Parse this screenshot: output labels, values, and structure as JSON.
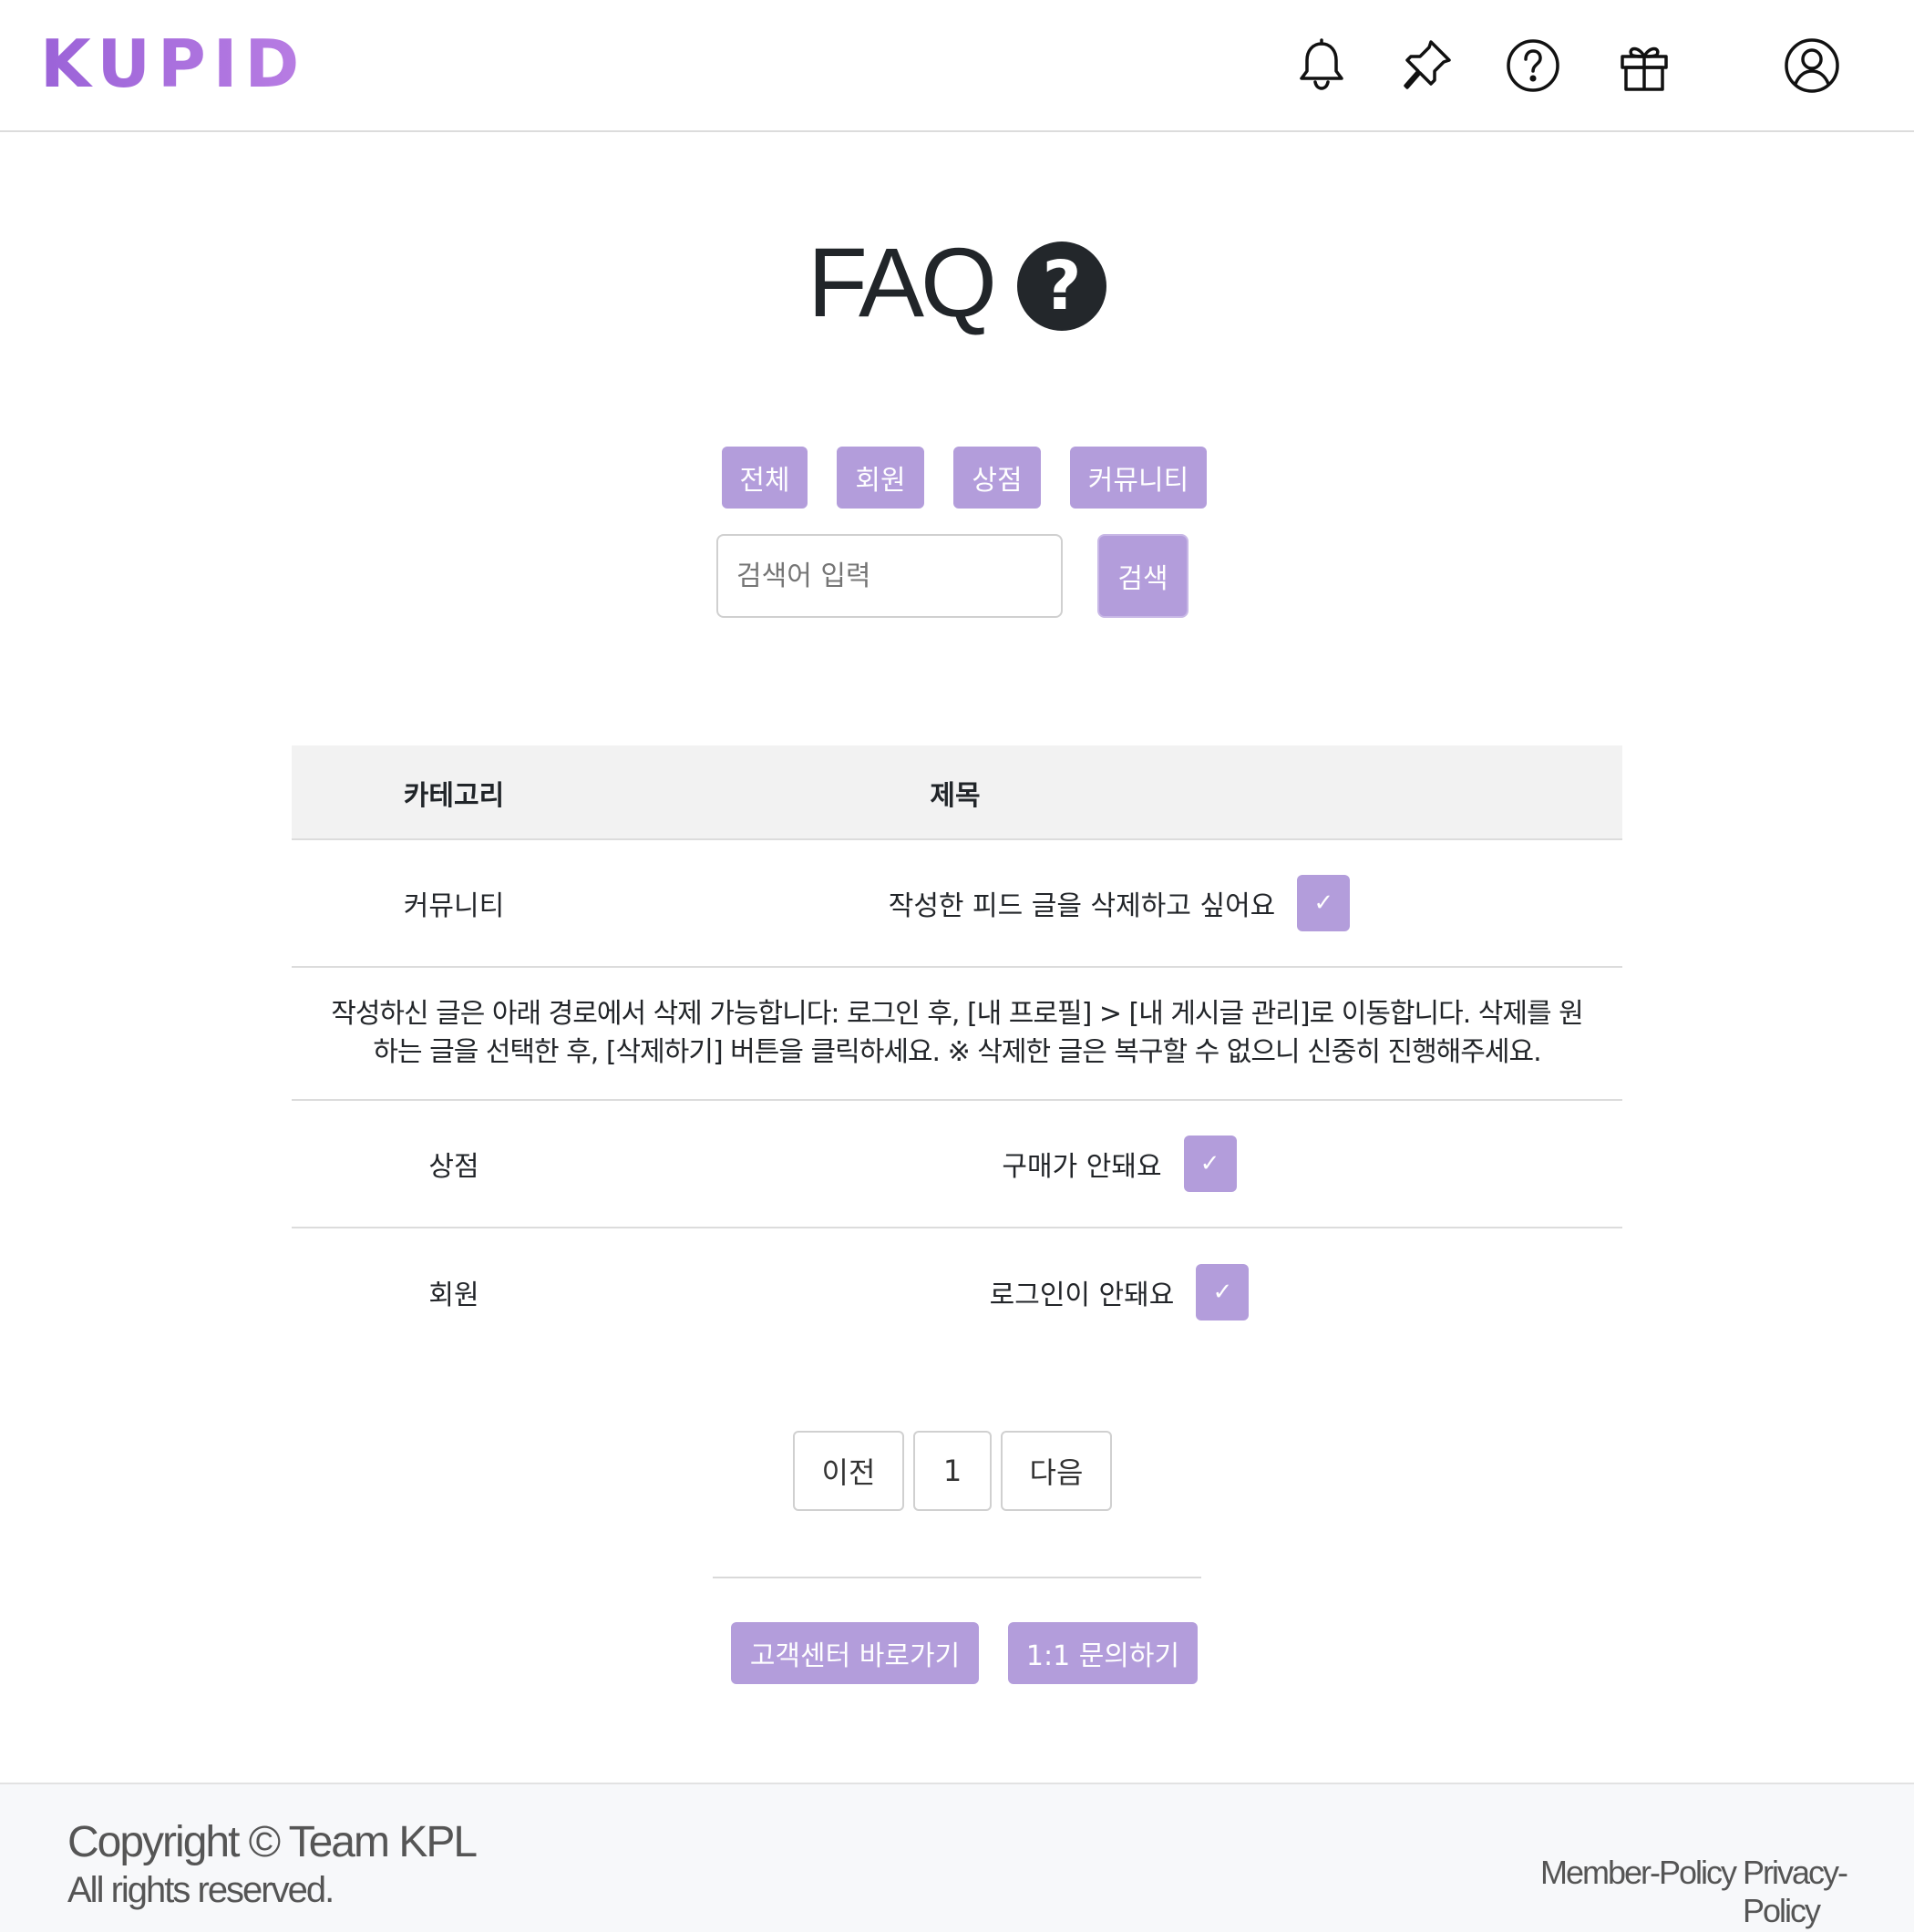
{
  "header": {
    "logo": "KUPID",
    "icons": [
      "bell-icon",
      "pin-icon",
      "help-icon",
      "gift-icon",
      "user-icon"
    ]
  },
  "page": {
    "title": "FAQ",
    "title_icon": "?"
  },
  "categories": [
    "전체",
    "회원",
    "상점",
    "커뮤니티"
  ],
  "search": {
    "placeholder": "검색어 입력",
    "value": "",
    "button": "검색"
  },
  "table": {
    "headers": {
      "category": "카테고리",
      "title": "제목"
    },
    "rows": [
      {
        "category": "커뮤니티",
        "title": "작성한 피드 글을 삭제하고 싶어요",
        "expanded": true,
        "answer": "작성하신 글은 아래 경로에서 삭제 가능합니다: 로그인 후, [내 프로필] > [내 게시글 관리]로 이동합니다. 삭제를 원하는 글을 선택한 후, [삭제하기] 버튼을 클릭하세요. ※ 삭제한 글은 복구할 수 없으니 신중히 진행해주세요."
      },
      {
        "category": "상점",
        "title": "구매가 안돼요",
        "expanded": false
      },
      {
        "category": "회원",
        "title": "로그인이 안돼요",
        "expanded": false
      }
    ],
    "toggle_glyph": "✓"
  },
  "pagination": {
    "prev": "이전",
    "current": "1",
    "next": "다음"
  },
  "actions": {
    "support_center": "고객센터 바로가기",
    "inquiry": "1:1 문의하기"
  },
  "footer": {
    "copyright": "Copyright © Team KPL",
    "rights": "All rights reserved.",
    "links": [
      "Member-Policy",
      "Privacy-Policy"
    ]
  },
  "colors": {
    "accent": "#b39ddb",
    "logo_gradient_start": "#9b63d8",
    "logo_gradient_end": "#b87de3",
    "table_header_bg": "#f2f2f2",
    "footer_bg": "#f7f8fa"
  }
}
